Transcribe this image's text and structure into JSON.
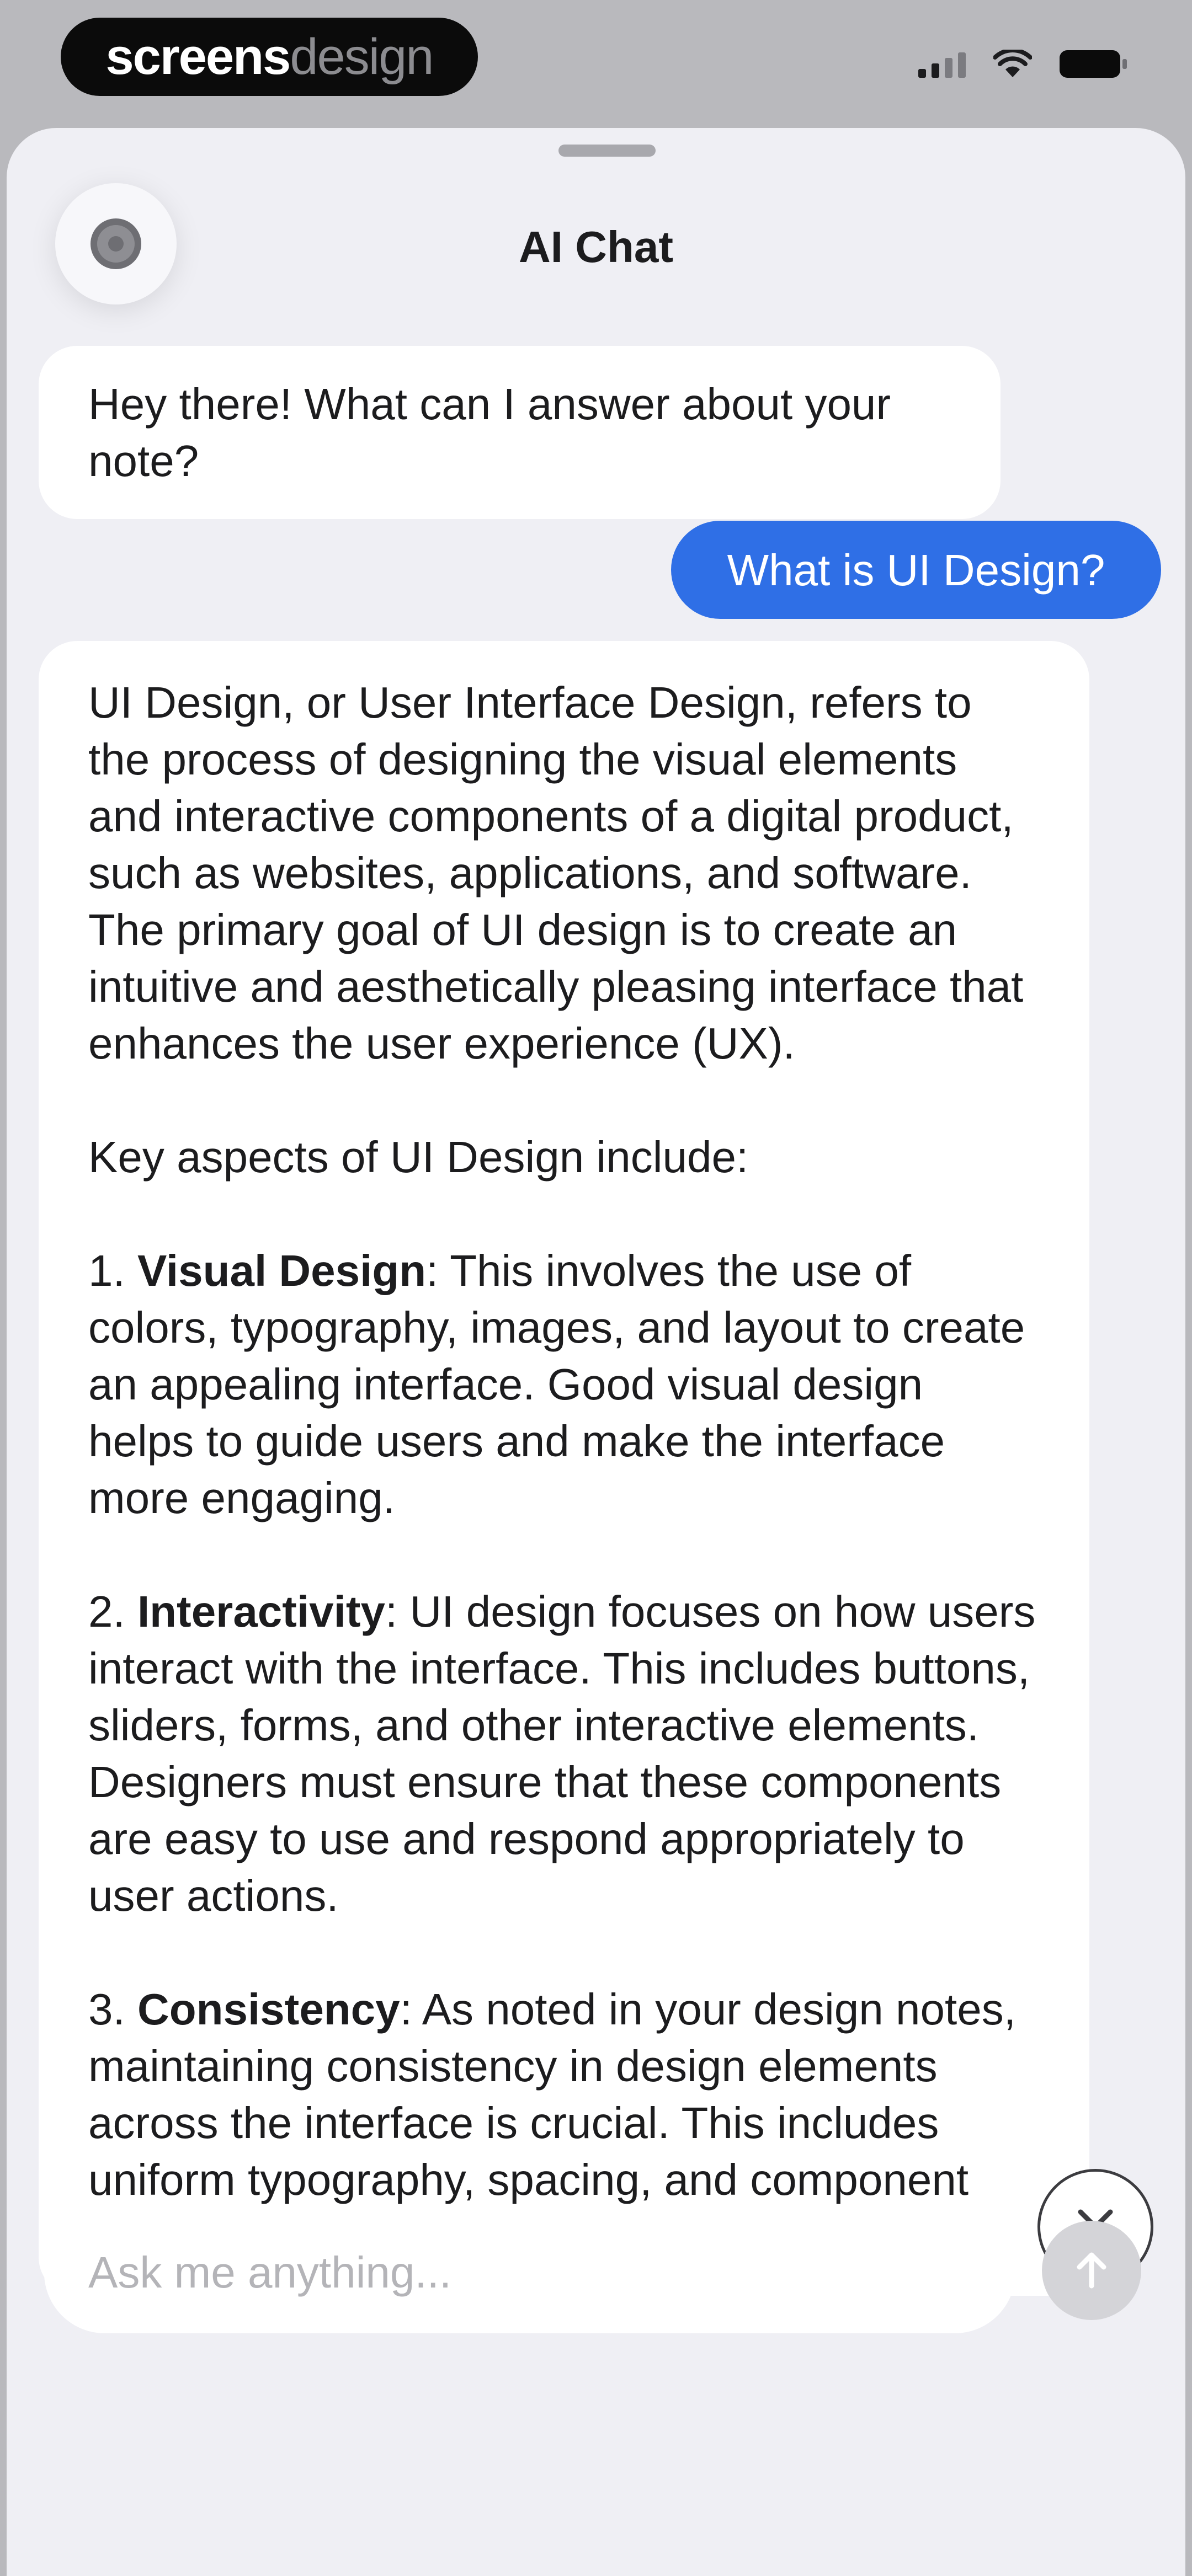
{
  "status_bar": {
    "brand_bold": "screens",
    "brand_light": "design"
  },
  "header": {
    "title": "AI Chat",
    "close_icon": "gear-icon"
  },
  "messages": {
    "greeting": "Hey there! What can I answer about your note?",
    "user_question": "What is UI Design?",
    "answer": {
      "intro": "UI Design, or User Interface Design, refers to the process of designing the visual elements and interactive components of a digital product, such as websites, applications, and software. The primary goal of UI design is to create an intuitive and aesthetically pleasing interface that enhances the user experience (UX).",
      "aspects_heading": "Key aspects of UI Design include:",
      "item1_num": "1. ",
      "item1_title": "Visual Design",
      "item1_text": ": This involves the use of colors, typography, images, and layout to create an appealing interface. Good visual design helps to guide users and make the interface more engaging.",
      "item2_num": "2. ",
      "item2_title": "Interactivity",
      "item2_text": ": UI design focuses on how users interact with the interface. This includes buttons, sliders, forms, and other interactive elements. Designers must ensure that these components are easy to use and respond appropriately to user actions.",
      "item3_num": "3. ",
      "item3_title": "Consistency",
      "item3_text": ": As noted in your design notes, maintaining consistency in design elements across the interface is crucial. This includes uniform typography, spacing, and component behavior, which helps users"
    }
  },
  "composer": {
    "placeholder": "Ask me anything..."
  },
  "colors": {
    "user_bubble": "#2f6fe6",
    "assistant_bubble": "#ffffff",
    "sheet_background": "#efeff4",
    "send_button_disabled": "#d4d4d8"
  }
}
